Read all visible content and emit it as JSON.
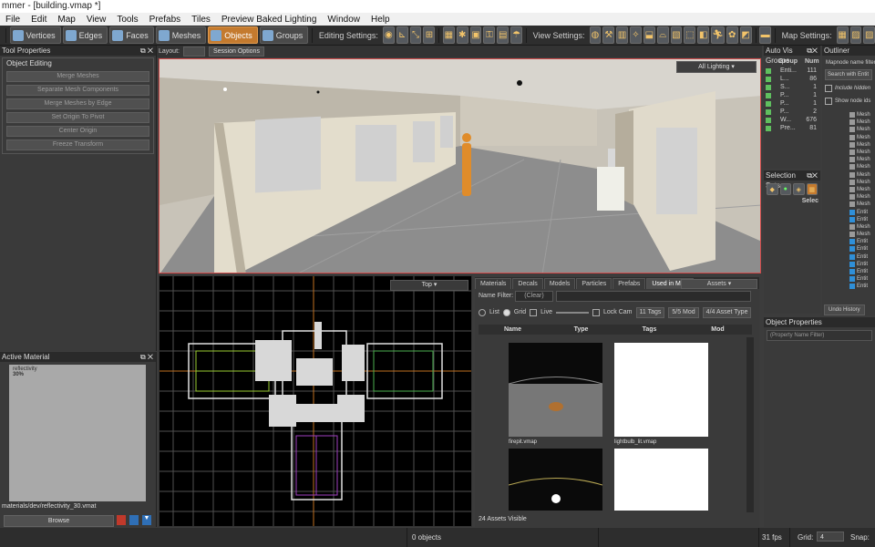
{
  "window": {
    "title": "mmer - [building.vmap *]"
  },
  "menu": [
    "File",
    "Edit",
    "Map",
    "View",
    "Tools",
    "Prefabs",
    "Tiles",
    "Preview Baked Lighting",
    "Window",
    "Help"
  ],
  "toolbar": {
    "modes": [
      {
        "label": "Vertices",
        "active": false
      },
      {
        "label": "Edges",
        "active": false
      },
      {
        "label": "Faces",
        "active": false
      },
      {
        "label": "Meshes",
        "active": false
      },
      {
        "label": "Objects",
        "active": true
      },
      {
        "label": "Groups",
        "active": false
      }
    ],
    "editing_settings_label": "Editing Settings:",
    "view_settings_label": "View Settings:",
    "map_settings_label": "Map Settings:"
  },
  "tool_properties": {
    "title": "Tool Properties",
    "group_title": "Object Editing",
    "buttons": [
      "Merge Meshes",
      "Separate Mesh Components",
      "Merge Meshes by Edge",
      "Set Origin To Pivot",
      "Center Origin",
      "Freeze Transform"
    ]
  },
  "active_material": {
    "title": "Active Material",
    "thumb_text_1": "reflectivity",
    "thumb_text_2": "30%",
    "path": "materials/dev/reflectivity_30.vmat",
    "browse_label": "Browse"
  },
  "layout_bar": {
    "label": "Layout:",
    "session_options": "Session Options"
  },
  "viewport3d": {
    "lighting_mode": "All Lighting"
  },
  "viewport2d": {
    "view": "Top"
  },
  "asset_browser": {
    "tabs": [
      {
        "label": "Materials",
        "selected": false
      },
      {
        "label": "Decals",
        "selected": false
      },
      {
        "label": "Models",
        "selected": false
      },
      {
        "label": "Particles",
        "selected": false
      },
      {
        "label": "Prefabs",
        "selected": false
      },
      {
        "label": "Used in Map",
        "selected": true
      }
    ],
    "assets_dropdown": "Assets",
    "name_filter_label": "Name Filter:",
    "clear_label": "(Clear)",
    "options": {
      "list": "List",
      "grid": "Grid",
      "live": "Live",
      "lock_cam": "Lock Cam",
      "tags": "11 Tags",
      "mod": "5/5 Mod",
      "asset_type": "4/4 Asset Type"
    },
    "columns": [
      "Name",
      "Type",
      "Tags",
      "Mod"
    ],
    "items": [
      "firepit.vmap",
      "lightbulb_lit.vmap",
      "",
      ""
    ],
    "visible_count": "24 Assets Visible"
  },
  "auto_vis_groups": {
    "title": "Auto Vis Groups",
    "columns": [
      "Group",
      "Num"
    ],
    "rows": [
      {
        "name": "Enti...",
        "num": "111"
      },
      {
        "name": "L...",
        "num": "86"
      },
      {
        "name": "S...",
        "num": "1"
      },
      {
        "name": "P...",
        "num": "1"
      },
      {
        "name": "P...",
        "num": "1"
      },
      {
        "name": "P...",
        "num": "2"
      },
      {
        "name": "W...",
        "num": "676"
      },
      {
        "name": "Pre...",
        "num": "81"
      }
    ]
  },
  "selection_sets": {
    "title": "Selection Sets",
    "column": "Selec"
  },
  "outliner": {
    "title": "Outliner",
    "filter_label": "Mapnode name filter",
    "search_placeholder": "Search with Entit",
    "include_hidden": "Include hidden",
    "show_node_ids": "Show node ids",
    "items": [
      "Mesh",
      "Mesh",
      "Mesh",
      "Mesh",
      "Mesh",
      "Mesh",
      "Mesh",
      "Mesh",
      "Mesh",
      "Mesh",
      "Mesh",
      "Mesh",
      "Mesh",
      "Entit",
      "Entit",
      "Mesh",
      "Mesh",
      "Entit",
      "Entit",
      "Entit",
      "Entit",
      "Entit",
      "Entit",
      "Entit"
    ],
    "undo_history": "Undo History"
  },
  "object_properties": {
    "title": "Object Properties",
    "placeholder": "(Property Name Filter)"
  },
  "status_bar": {
    "objects": "0 objects",
    "fps": "31 fps",
    "grid_label": "Grid:",
    "grid_value": "4",
    "snap_label": "Snap:"
  },
  "colors": {
    "accent": "#c47a2e",
    "viewport_border": "#d04848",
    "check": "#5fbf5f"
  }
}
